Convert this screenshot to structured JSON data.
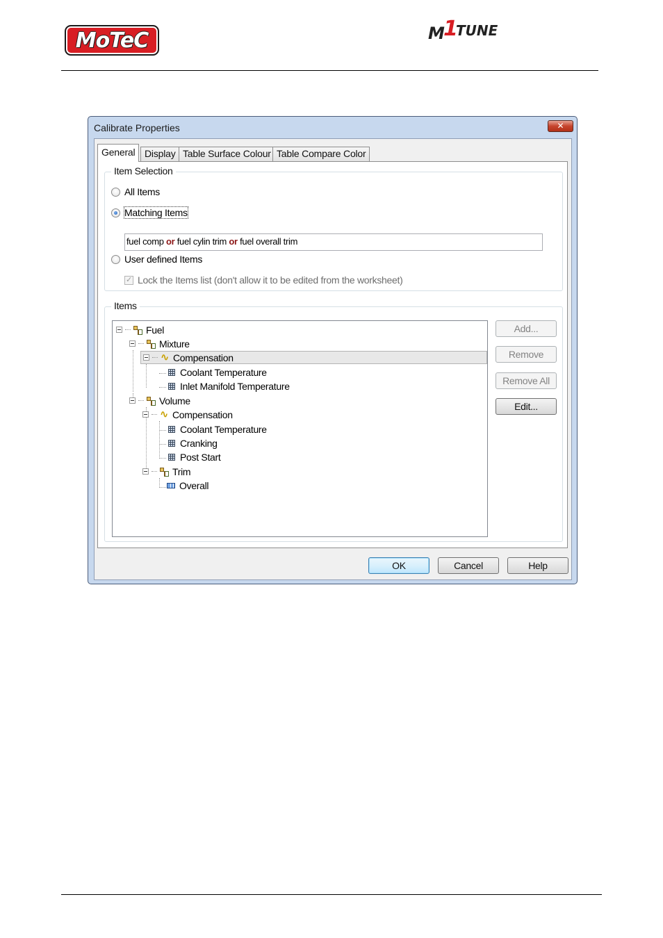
{
  "header": {
    "brand_logo": "MoTeC",
    "product_logo": {
      "m": "M",
      "one": "1",
      "tune": "TUNE"
    }
  },
  "dialog": {
    "title": "Calibrate Properties",
    "close_glyph": "✕",
    "tabs": [
      {
        "label": "General",
        "active": true
      },
      {
        "label": "Display",
        "active": false
      },
      {
        "label": "Table Surface Colour",
        "active": false
      },
      {
        "label": "Table Compare Color",
        "active": false
      }
    ],
    "item_selection": {
      "legend": "Item Selection",
      "all_items": {
        "label": "All Items",
        "checked": false
      },
      "matching_items": {
        "label": "Matching Items",
        "checked": true
      },
      "match_expression": {
        "parts": [
          "fuel comp",
          "or",
          "fuel cylin trim",
          "or",
          "fuel overall trim"
        ]
      },
      "user_defined_items": {
        "label": "User defined Items",
        "checked": false
      },
      "lock_items": {
        "label": "Lock the Items list (don't allow it to be edited from the worksheet)",
        "checked": true,
        "enabled": false,
        "check_glyph": "✓"
      }
    },
    "items": {
      "legend": "Items",
      "tree": [
        {
          "label": "Fuel",
          "icon": "folder-icon",
          "expander": true
        },
        {
          "label": "Mixture",
          "icon": "folder-icon",
          "expander": true
        },
        {
          "label": "Compensation",
          "icon": "wave-icon",
          "expander": true,
          "selected": true,
          "wave_glyph": "∿"
        },
        {
          "label": "Coolant Temperature",
          "icon": "table-icon"
        },
        {
          "label": "Inlet Manifold Temperature",
          "icon": "table-icon"
        },
        {
          "label": "Volume",
          "icon": "folder-icon",
          "expander": true
        },
        {
          "label": "Compensation",
          "icon": "wave-icon",
          "expander": true,
          "wave_glyph": "∿"
        },
        {
          "label": "Coolant Temperature",
          "icon": "table-icon"
        },
        {
          "label": "Cranking",
          "icon": "table-icon"
        },
        {
          "label": "Post Start",
          "icon": "table-icon"
        },
        {
          "label": "Trim",
          "icon": "folder-icon",
          "expander": true
        },
        {
          "label": "Overall",
          "icon": "value-icon"
        }
      ],
      "buttons": {
        "add": {
          "label": "Add...",
          "enabled": false
        },
        "remove": {
          "label": "Remove",
          "enabled": false
        },
        "remove_all": {
          "label": "Remove All",
          "enabled": false
        },
        "edit": {
          "label": "Edit...",
          "enabled": true
        }
      }
    },
    "footer_buttons": {
      "ok": "OK",
      "cancel": "Cancel",
      "help": "Help"
    }
  },
  "colors": {
    "motec_red": "#d81e24",
    "keyword": "#8b1515",
    "dialog_frame": "#c7d8ee"
  }
}
